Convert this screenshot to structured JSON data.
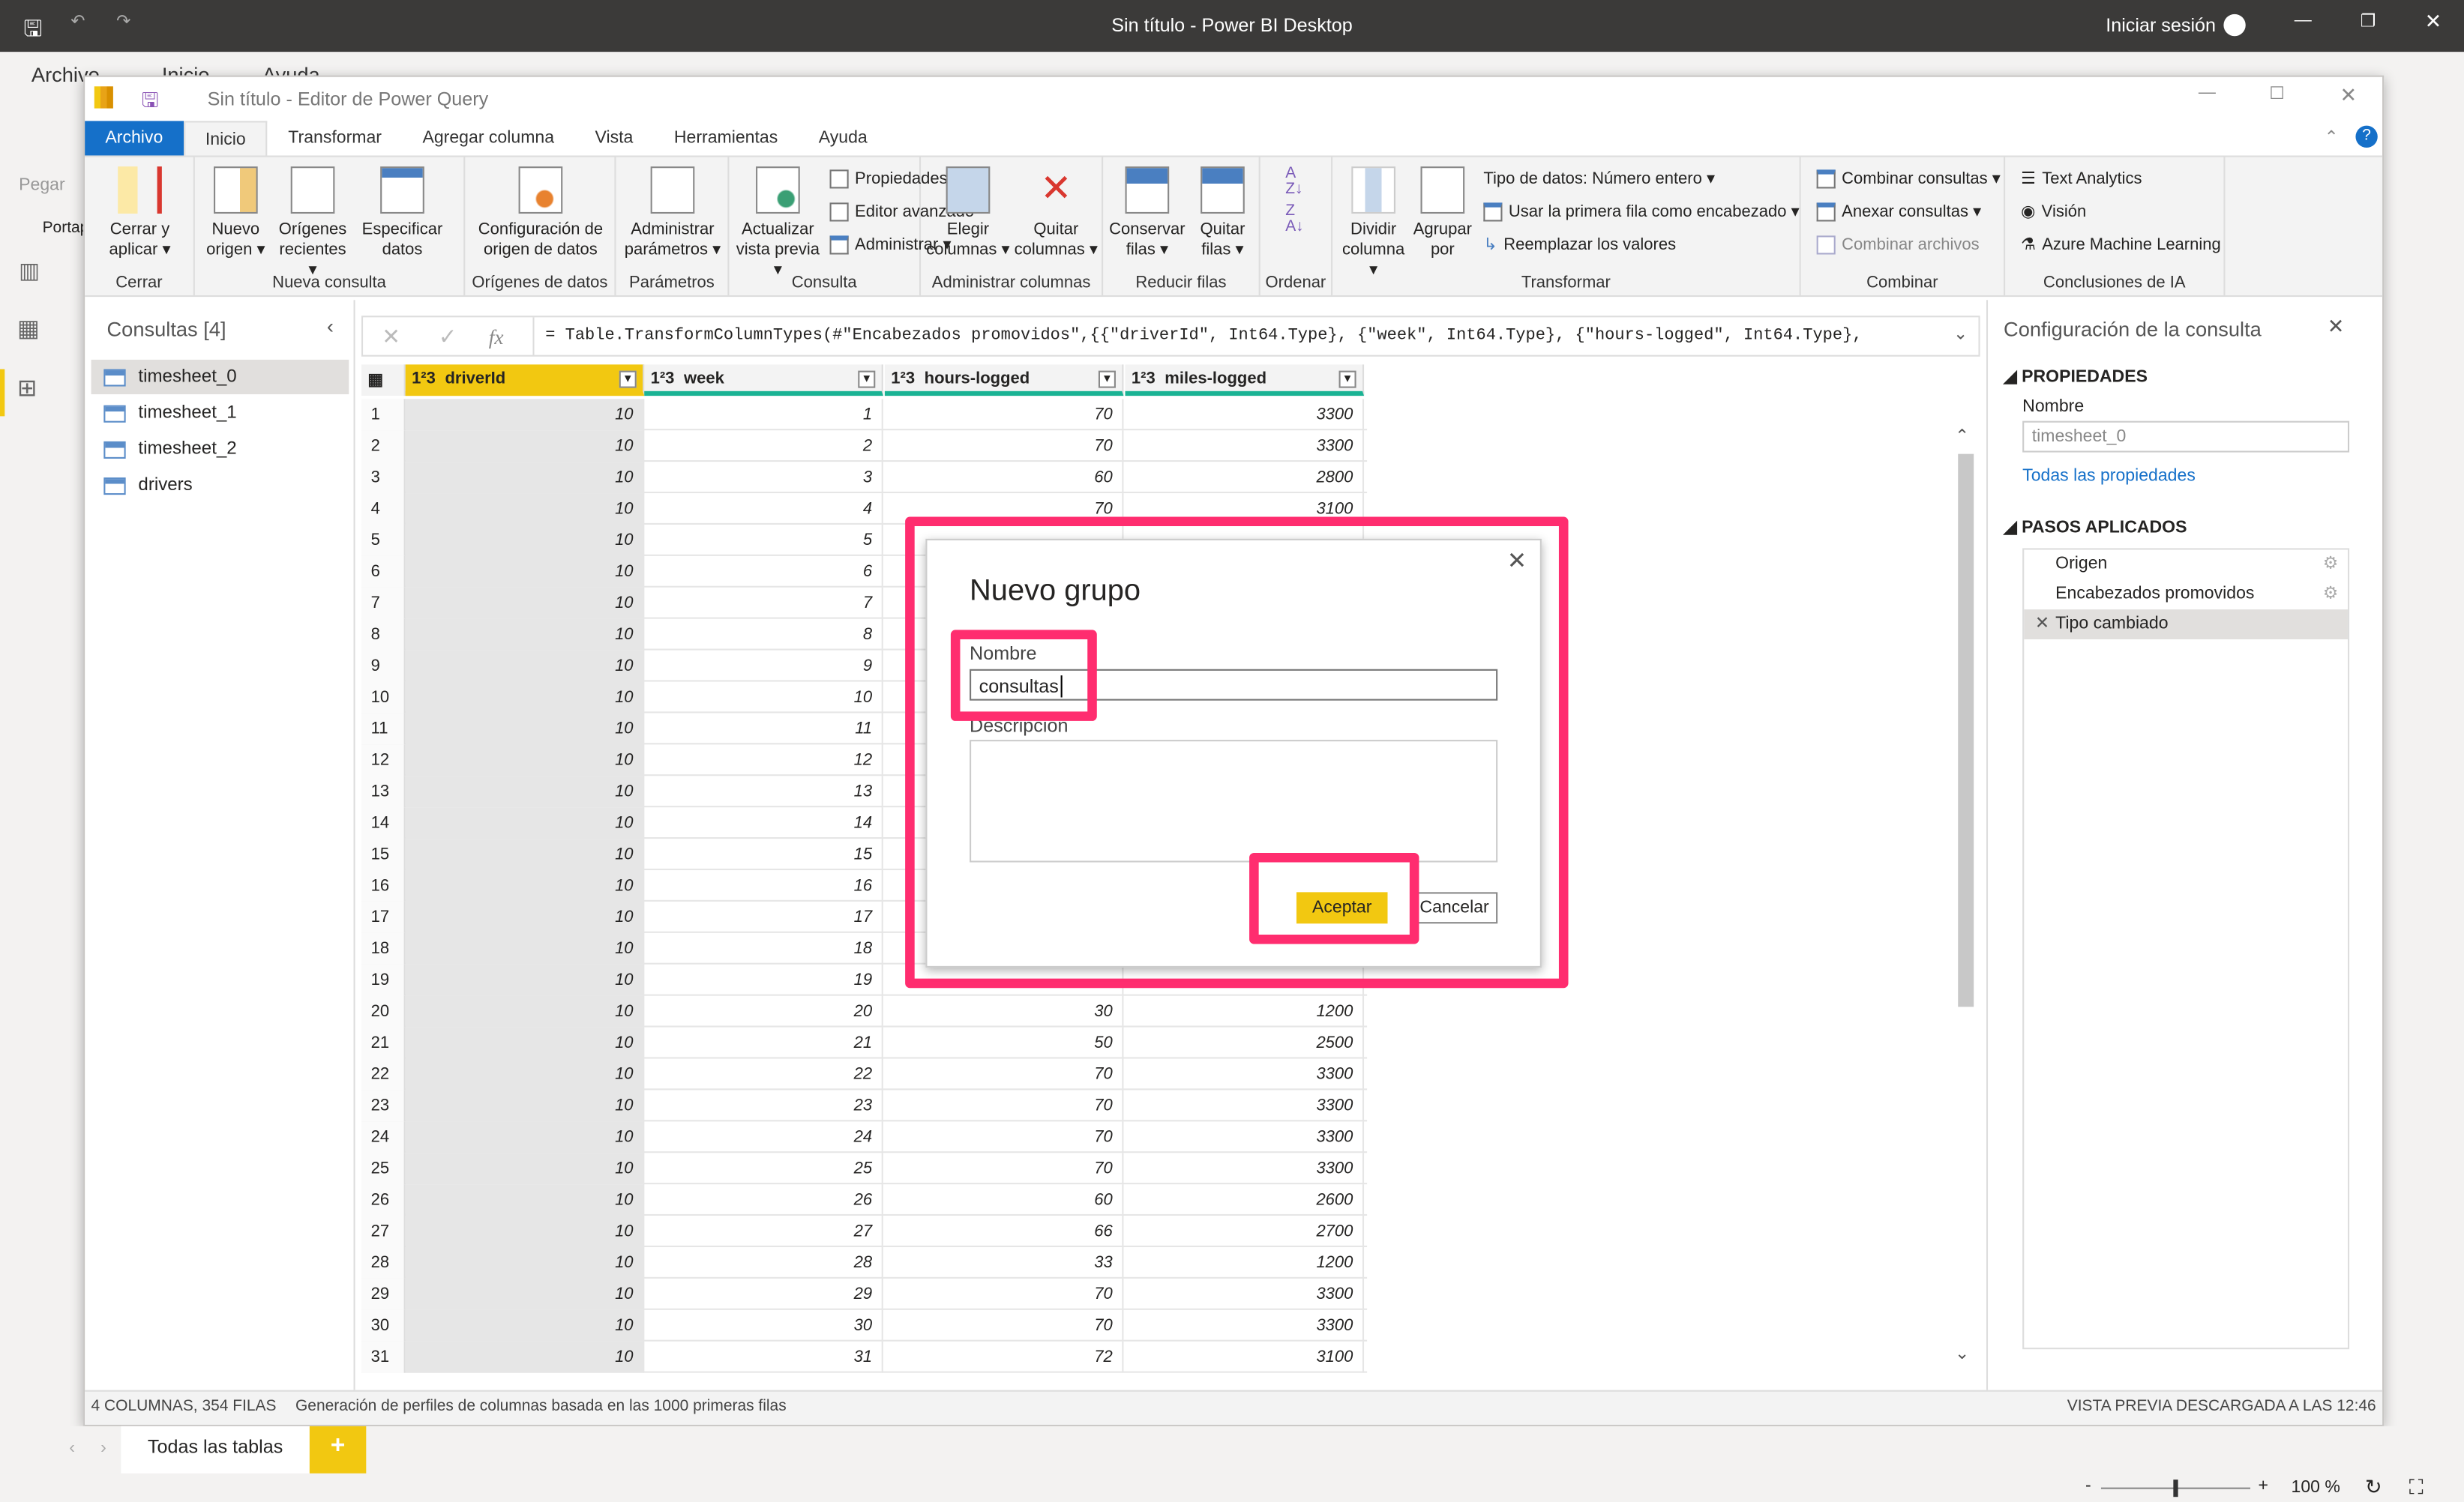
{
  "app": {
    "title": "Sin título - Power BI Desktop",
    "signin": "Iniciar sesión",
    "menu": [
      "Archivo",
      "Inicio",
      "Ayuda"
    ],
    "paste": "Pegar",
    "portap": "Portap"
  },
  "editor": {
    "title": "Sin título - Editor de Power Query",
    "tabs": [
      "Archivo",
      "Inicio",
      "Transformar",
      "Agregar columna",
      "Vista",
      "Herramientas",
      "Ayuda"
    ],
    "groups": {
      "cerrar": "Cerrar",
      "nueva": "Nueva consulta",
      "origenes": "Orígenes de datos",
      "param": "Parámetros",
      "consulta": "Consulta",
      "admcol": "Administrar columnas",
      "reducir": "Reducir filas",
      "ordenar": "Ordenar",
      "transformar": "Transformar",
      "combinar": "Combinar",
      "ia": "Conclusiones de IA"
    },
    "buttons": {
      "cerrar1": "Cerrar y",
      "cerrar2": "aplicar ▾",
      "nuevo1": "Nuevo",
      "nuevo2": "origen ▾",
      "rec1": "Orígenes",
      "rec2": "recientes ▾",
      "esp1": "Especificar",
      "esp2": "datos",
      "conf1": "Configuración de",
      "conf2": "origen de datos",
      "adm1": "Administrar",
      "adm2": "parámetros ▾",
      "act1": "Actualizar",
      "act2": "vista previa ▾",
      "prop": "Propiedades",
      "editor": "Editor avanzado",
      "admin": "Administrar ▾",
      "eleg1": "Elegir",
      "eleg2": "columnas ▾",
      "quit1": "Quitar",
      "quit2": "columnas ▾",
      "cons1": "Conservar",
      "cons2": "filas ▾",
      "qf1": "Quitar",
      "qf2": "filas ▾",
      "div1": "Dividir",
      "div2": "columna ▾",
      "agr1": "Agrupar",
      "agr2": "por",
      "tipo": "Tipo de datos: Número entero ▾",
      "primera": "Usar la primera fila como encabezado ▾",
      "reemp": "Reemplazar los valores",
      "combc": "Combinar consultas ▾",
      "anex": "Anexar consultas ▾",
      "comba": "Combinar archivos",
      "text": "Text Analytics",
      "vision": "Visión",
      "azure": "Azure Machine Learning"
    },
    "queries": {
      "title": "Consultas [4]",
      "items": [
        "timesheet_0",
        "timesheet_1",
        "timesheet_2",
        "drivers"
      ]
    },
    "formula": "= Table.TransformColumnTypes(#\"Encabezados promovidos\",{{\"driverId\", Int64.Type}, {\"week\", Int64.Type}, {\"hours-logged\", Int64.Type},",
    "fx": "fx",
    "columns": [
      {
        "type": "1²3",
        "name": "driverId"
      },
      {
        "type": "1²3",
        "name": "week"
      },
      {
        "type": "1²3",
        "name": "hours-logged"
      },
      {
        "type": "1²3",
        "name": "miles-logged"
      }
    ],
    "rows": [
      [
        10,
        1,
        70,
        3300
      ],
      [
        10,
        2,
        70,
        3300
      ],
      [
        10,
        3,
        60,
        2800
      ],
      [
        10,
        4,
        70,
        3100
      ],
      [
        10,
        5,
        "",
        ""
      ],
      [
        10,
        6,
        "",
        ""
      ],
      [
        10,
        7,
        "",
        ""
      ],
      [
        10,
        8,
        "",
        ""
      ],
      [
        10,
        9,
        "",
        ""
      ],
      [
        10,
        10,
        "",
        ""
      ],
      [
        10,
        11,
        "",
        ""
      ],
      [
        10,
        12,
        "",
        ""
      ],
      [
        10,
        13,
        "",
        ""
      ],
      [
        10,
        14,
        "",
        ""
      ],
      [
        10,
        15,
        "",
        ""
      ],
      [
        10,
        16,
        "",
        ""
      ],
      [
        10,
        17,
        "",
        ""
      ],
      [
        10,
        18,
        "",
        ""
      ],
      [
        10,
        19,
        "",
        ""
      ],
      [
        10,
        20,
        30,
        1200
      ],
      [
        10,
        21,
        50,
        2500
      ],
      [
        10,
        22,
        70,
        3300
      ],
      [
        10,
        23,
        70,
        3300
      ],
      [
        10,
        24,
        70,
        3300
      ],
      [
        10,
        25,
        70,
        3300
      ],
      [
        10,
        26,
        60,
        2600
      ],
      [
        10,
        27,
        66,
        2700
      ],
      [
        10,
        28,
        33,
        1200
      ],
      [
        10,
        29,
        70,
        3300
      ],
      [
        10,
        30,
        70,
        3300
      ],
      [
        10,
        31,
        72,
        3100
      ]
    ],
    "settings": {
      "title": "Configuración de la consulta",
      "props": "PROPIEDADES",
      "name_label": "Nombre",
      "name_value": "timesheet_0",
      "all_props": "Todas las propiedades",
      "steps_title": "PASOS APLICADOS",
      "steps": [
        "Origen",
        "Encabezados promovidos",
        "Tipo cambiado"
      ]
    },
    "status": {
      "left": "4 COLUMNAS, 354 FILAS",
      "profile": "Generación de perfiles de columnas basada en las 1000 primeras filas",
      "right": "VISTA PREVIA DESCARGADA A LAS 12:46"
    }
  },
  "dialog": {
    "title": "Nuevo grupo",
    "name_label": "Nombre",
    "name_value": "consultas",
    "desc_label": "Descripción",
    "ok": "Aceptar",
    "cancel": "Cancelar"
  },
  "bottom": {
    "tab": "Todas las tablas",
    "add": "+",
    "zoom": "100 %"
  },
  "colors": {
    "accent": "#1570c9",
    "highlight": "#ff2d6f",
    "ok_button": "#f2c811",
    "header_selected": "#f2c811"
  }
}
